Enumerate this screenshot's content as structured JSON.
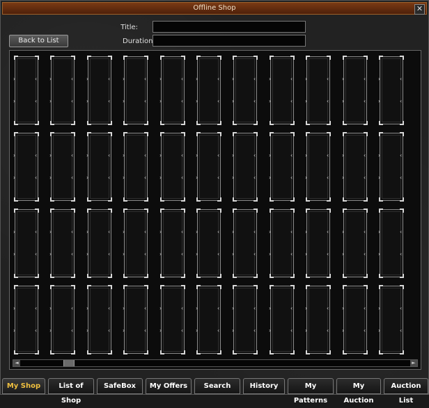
{
  "window": {
    "title": "Offline Shop",
    "close_glyph": "✕"
  },
  "form": {
    "title_label": "Title:",
    "title_value": "",
    "duration_label": "Duration:",
    "duration_value": ""
  },
  "back_button": {
    "label": "Back to List"
  },
  "grid": {
    "rows": 4,
    "columns": 11
  },
  "scrollbar": {
    "left_arrow": "◄",
    "right_arrow": "►"
  },
  "tabs": [
    {
      "label": "My Shop",
      "active": true
    },
    {
      "label": "List of Shop",
      "active": false
    },
    {
      "label": "SafeBox",
      "active": false
    },
    {
      "label": "My Offers",
      "active": false
    },
    {
      "label": "Search",
      "active": false
    },
    {
      "label": "History",
      "active": false
    },
    {
      "label": "My Patterns",
      "active": false
    },
    {
      "label": "My Auction",
      "active": false
    },
    {
      "label": "Auction List",
      "active": false
    }
  ],
  "colors": {
    "title_bar": "#5e2a0e",
    "active_tab_text": "#f0c040",
    "panel_bg": "#0c0c0c"
  }
}
